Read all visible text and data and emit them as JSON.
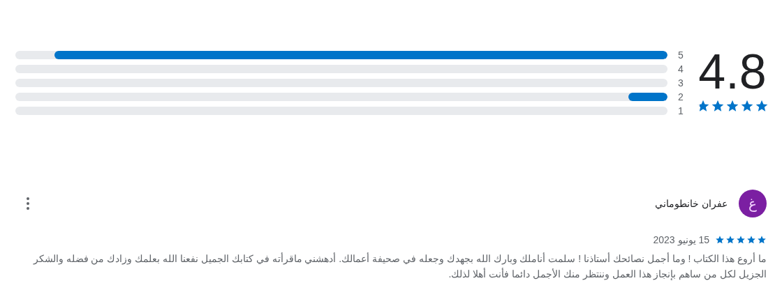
{
  "summary": {
    "score": "4.8",
    "stars": 4.8,
    "bars": [
      {
        "label": "5",
        "level": 0.94
      },
      {
        "label": "4",
        "level": 0
      },
      {
        "label": "3",
        "level": 0
      },
      {
        "label": "2",
        "level": 0.06
      },
      {
        "label": "1",
        "level": 0
      }
    ]
  },
  "review": {
    "author": "عفران خانطوماني",
    "avatar_letter": "غ",
    "stars": 5,
    "date": "15 يونيو 2023",
    "text": "ما أروع هذا الكتاب ! وما أجمل نصائحك أستاذنا ! سلمت أناملك وبارك الله بجهدك وجعله في صحيفة أعمالك. أدهشني ماقرأته في كتابك الجميل نفعنا الله بعلمك وزادك من فضله والشكر الجزيل لكل من ساهم بإنجاز هذا العمل وننتظر منك الأجمل دائما فأنت أهلا لذلك."
  }
}
